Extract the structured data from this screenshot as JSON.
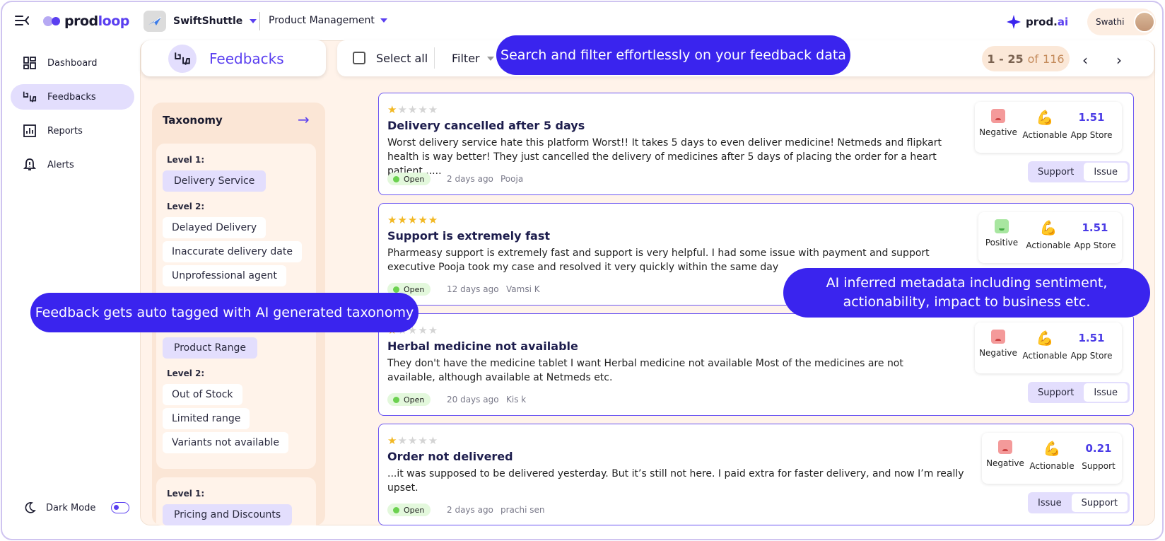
{
  "app": {
    "logo_text_a": "prod",
    "logo_text_b": "loop"
  },
  "project": {
    "name": "SwiftShuttle",
    "module": "Product Management"
  },
  "brand": {
    "prodai_a": "prod.",
    "prodai_b": "ai"
  },
  "user": {
    "name": "Swathi"
  },
  "sidebar": {
    "items": [
      {
        "label": "Dashboard",
        "icon": "dashboard-icon"
      },
      {
        "label": "Feedbacks",
        "icon": "feedback-icon",
        "active": true
      },
      {
        "label": "Reports",
        "icon": "reports-icon"
      },
      {
        "label": "Alerts",
        "icon": "alert-bell-icon"
      }
    ],
    "dark_mode_label": "Dark Mode"
  },
  "feedbacks": {
    "title": "Feedbacks"
  },
  "toolbar": {
    "select_all": "Select all",
    "filter": "Filter"
  },
  "pager": {
    "range": "1 - 25",
    "of": "of",
    "total": "116"
  },
  "taxonomy": {
    "title": "Taxonomy",
    "groups": [
      {
        "level1_label": "Level 1:",
        "level1": "Delivery Service",
        "level2_label": "Level 2:",
        "level2": [
          "Delayed Delivery",
          "Inaccurate delivery date",
          "Unprofessional agent"
        ]
      },
      {
        "level1": "Product Range",
        "level2_label": "Level 2:",
        "level2": [
          "Out of Stock",
          "Limited range",
          "Variants not available"
        ]
      },
      {
        "level1_label": "Level 1:",
        "level1": "Pricing and Discounts"
      }
    ]
  },
  "cards": [
    {
      "rating": 1,
      "title": "Delivery cancelled after 5 days",
      "body": "Worst delivery service hate this platform Worst!! It takes 5 days to even deliver medicine! Netmeds and flipkart health is way better! They just cancelled the delivery of medicines after 5 days of placing the order for a heart patient......",
      "status": "Open",
      "time": "2 days ago",
      "author": "Pooja",
      "sentiment": "Negative",
      "actionability": "Actionable",
      "impact": "1.51",
      "source": "App Store",
      "chips": [
        "Support",
        "Issue"
      ]
    },
    {
      "rating": 5,
      "title": "Support is extremely fast",
      "body": "Pharmeasy support is extremely fast and support is very helpful. I had some issue with payment and support executive Pooja took my case and resolved it very quickly within the same day",
      "status": "Open",
      "time": "12 days ago",
      "author": "Vamsi  K",
      "sentiment": "Positive",
      "actionability": "Actionable",
      "impact": "1.51",
      "source": "App Store",
      "chips": []
    },
    {
      "rating": 1,
      "title": "Herbal medicine not available",
      "body": "They don't have the medicine tablet I want Herbal medicine not available Most of the medicines are not available, although available at Netmeds etc.",
      "status": "Open",
      "time": "20 days ago",
      "author": "Kis k",
      "sentiment": "Negative",
      "actionability": "Actionable",
      "impact": "1.51",
      "source": "App Store",
      "chips": [
        "Support",
        "Issue"
      ]
    },
    {
      "rating": 1,
      "title": "Order not delivered",
      "body": "...it was supposed to be delivered yesterday. But it’s still not here. I paid extra for faster delivery, and now I’m really upset.",
      "status": "Open",
      "time": "2 days ago",
      "author": "prachi sen",
      "sentiment": "Negative",
      "actionability": "Actionable",
      "impact": "0.21",
      "source": "Support",
      "chips": [
        "Issue",
        "Support"
      ]
    }
  ],
  "callouts": {
    "search": "Search and filter effortlessly on your feedback data",
    "taxonomy": "Feedback gets auto tagged with AI generated taxonomy",
    "metadata_line1": "AI inferred metadata including sentiment,",
    "metadata_line2": "actionability, impact to business etc."
  },
  "colors": {
    "accent": "#5a3ff0",
    "callout": "#3a24ee",
    "panel": "#fff3ea",
    "tag": "#e3defd"
  }
}
